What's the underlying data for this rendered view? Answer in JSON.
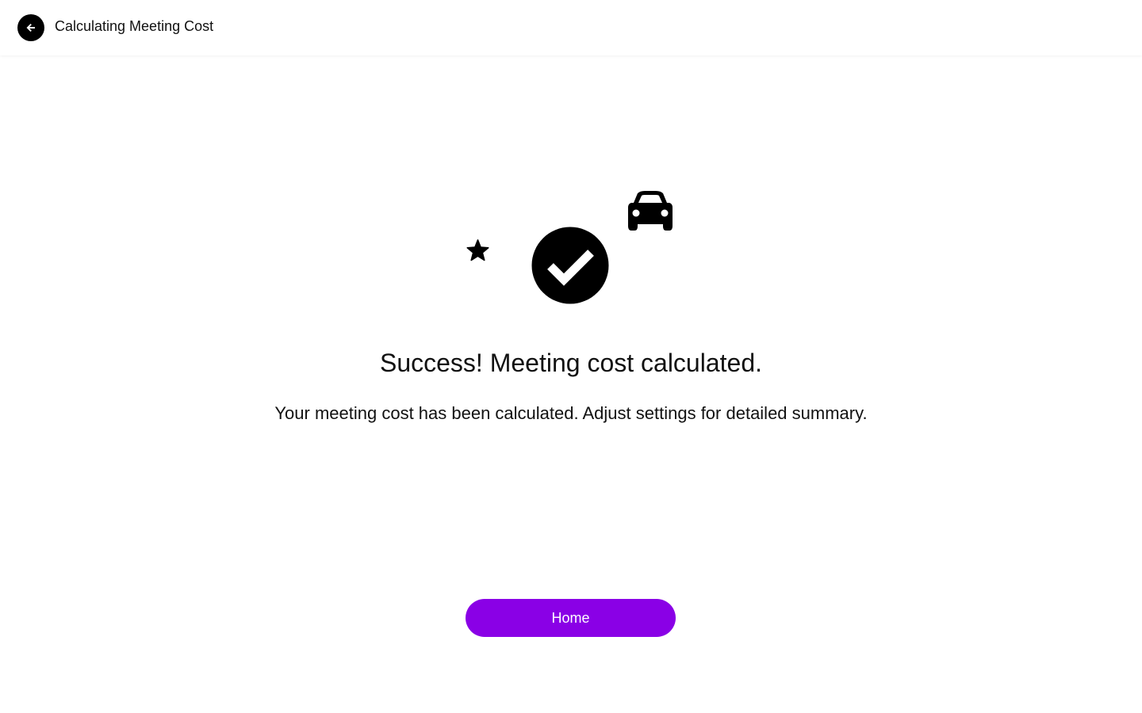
{
  "header": {
    "title": "Calculating Meeting Cost",
    "back_icon": "arrow-left-icon"
  },
  "illustration": {
    "icons": [
      "star-icon",
      "check-circle-icon",
      "car-icon"
    ]
  },
  "result": {
    "title": "Success! Meeting cost calculated.",
    "message": "Your meeting cost has been calculated. Adjust settings for detailed summary."
  },
  "actions": {
    "home_label": "Home"
  },
  "colors": {
    "accent": "#8a00e6",
    "icon": "#000000",
    "background": "#ffffff"
  }
}
